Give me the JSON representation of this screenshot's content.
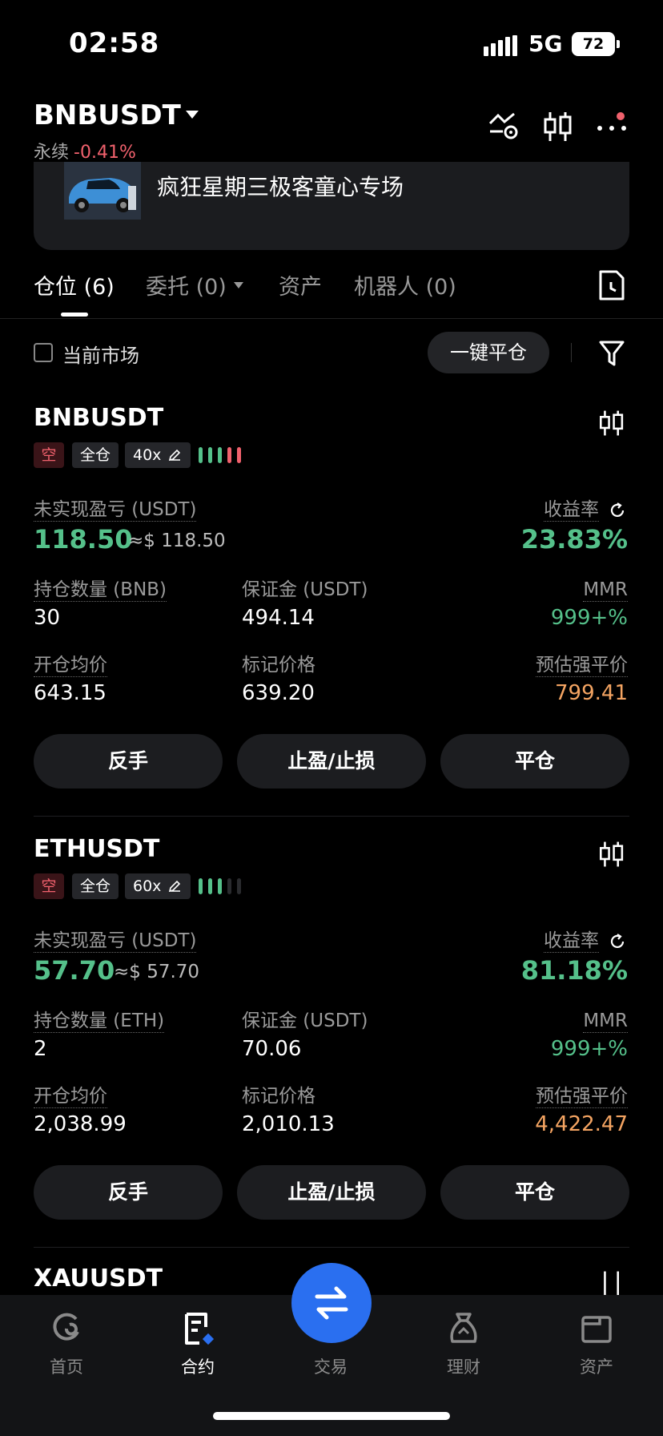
{
  "status_bar": {
    "time": "02:58",
    "network": "5G",
    "battery": "72"
  },
  "header": {
    "symbol": "BNBUSDT",
    "contract_type": "永续",
    "change": "-0.41%"
  },
  "banner": {
    "text": "疯狂星期三极客童心专场"
  },
  "tabs": [
    {
      "label": "仓位 (6)",
      "active": true
    },
    {
      "label": "委托 (0)",
      "active": false
    },
    {
      "label": "资产",
      "active": false
    },
    {
      "label": "机器人 (0)",
      "active": false
    }
  ],
  "filter": {
    "checkbox_label": "当前市场",
    "close_all_label": "一键平仓"
  },
  "positions": [
    {
      "symbol": "BNBUSDT",
      "side": "空",
      "margin_mode": "全仓",
      "leverage": "40x",
      "pnl_label": "未实现盈亏 (USDT)",
      "pnl": "118.50",
      "pnl_usd": "≈$ 118.50",
      "roe_label": "收益率",
      "roe": "23.83%",
      "qty_label": "持仓数量 (BNB)",
      "qty": "30",
      "margin_label": "保证金 (USDT)",
      "margin": "494.14",
      "mmr_label": "MMR",
      "mmr": "999+%",
      "entry_label": "开仓均价",
      "entry": "643.15",
      "mark_label": "标记价格",
      "mark": "639.20",
      "liq_label": "预估强平价",
      "liq": "799.41",
      "btn_reverse": "反手",
      "btn_tpsl": "止盈/止损",
      "btn_close": "平仓"
    },
    {
      "symbol": "ETHUSDT",
      "side": "空",
      "margin_mode": "全仓",
      "leverage": "60x",
      "pnl_label": "未实现盈亏 (USDT)",
      "pnl": "57.70",
      "pnl_usd": "≈$ 57.70",
      "roe_label": "收益率",
      "roe": "81.18%",
      "qty_label": "持仓数量 (ETH)",
      "qty": "2",
      "margin_label": "保证金 (USDT)",
      "margin": "70.06",
      "mmr_label": "MMR",
      "mmr": "999+%",
      "entry_label": "开仓均价",
      "entry": "2,038.99",
      "mark_label": "标记价格",
      "mark": "2,010.13",
      "liq_label": "预估强平价",
      "liq": "4,422.47",
      "btn_reverse": "反手",
      "btn_tpsl": "止盈/止损",
      "btn_close": "平仓"
    }
  ],
  "next_position_symbol": "XAUUSDT",
  "nav": [
    {
      "label": "首页",
      "icon": "home-icon"
    },
    {
      "label": "合约",
      "icon": "contract-icon"
    },
    {
      "label": "交易",
      "icon": "trade-swap-icon"
    },
    {
      "label": "理财",
      "icon": "earn-icon"
    },
    {
      "label": "资产",
      "icon": "wallet-icon"
    }
  ],
  "colors": {
    "profit_green": "#55c08a",
    "loss_red": "#f0616d",
    "liq_orange": "#f4a462",
    "accent_blue": "#2a6ff0"
  }
}
